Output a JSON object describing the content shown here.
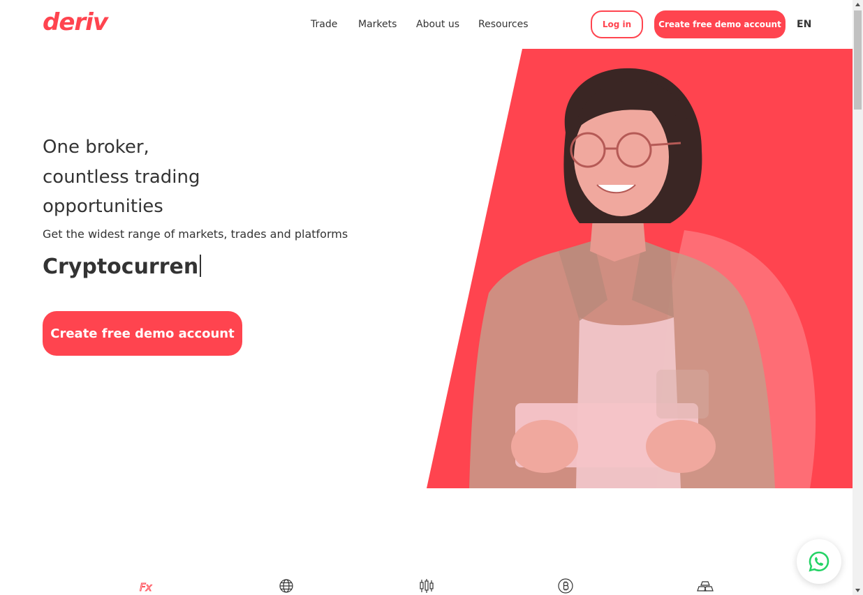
{
  "header": {
    "logo": "deriv",
    "nav": [
      {
        "label": "Trade"
      },
      {
        "label": "Markets"
      },
      {
        "label": "About us"
      },
      {
        "label": "Resources"
      }
    ],
    "login_label": "Log in",
    "demo_label": "Create free demo account",
    "language": "EN"
  },
  "hero": {
    "title_lines": [
      "One broker,",
      "countless trading",
      "opportunities"
    ],
    "subtitle": "Get the widest range of markets, trades and platforms",
    "typed_text": "Cryptocurren",
    "cta_label": "Create free demo account"
  },
  "markets": {
    "icons": [
      "forex-icon",
      "globe-icon",
      "candlestick-icon",
      "bitcoin-icon",
      "gold-bars-icon"
    ],
    "forex_glyph": "Fx"
  },
  "colors": {
    "brand": "#ff444f",
    "text": "#333333",
    "whatsapp": "#25d366"
  }
}
